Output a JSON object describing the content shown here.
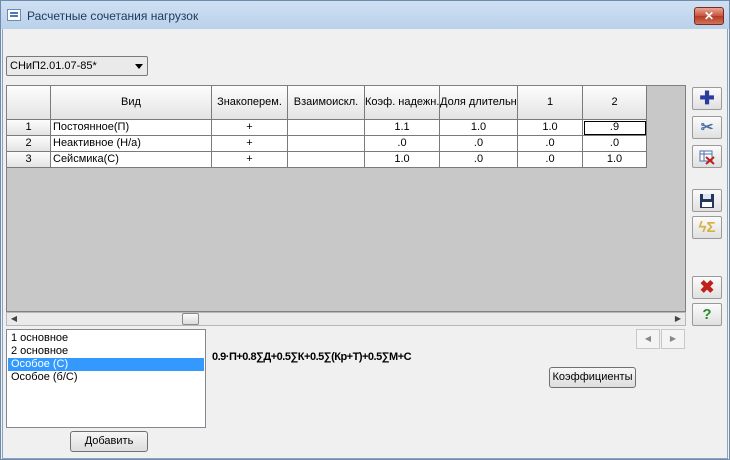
{
  "window": {
    "title": "Расчетные сочетания нагрузок",
    "close": "✕"
  },
  "norm_select": {
    "value": "СНиП2.01.07-85*"
  },
  "table": {
    "columns": [
      "Вид",
      "Знакоперем.",
      "Взаимоискл.",
      "Коэф. надежн.",
      "Доля длительн.",
      "1",
      "2"
    ],
    "rows": [
      {
        "num": "1",
        "vid": "Постоянное(П)",
        "znak": "+",
        "vzaim": "",
        "koef": "1.1",
        "dolya": "1.0",
        "c1": "1.0",
        "c2": ".9"
      },
      {
        "num": "2",
        "vid": "Неактивное (Н/а)",
        "znak": "+",
        "vzaim": "",
        "koef": ".0",
        "dolya": ".0",
        "c1": ".0",
        "c2": ".0"
      },
      {
        "num": "3",
        "vid": "Сейсмика(С)",
        "znak": "+",
        "vzaim": "",
        "koef": "1.0",
        "dolya": ".0",
        "c1": ".0",
        "c2": "1.0"
      }
    ]
  },
  "combos": [
    "1 основное",
    "2 основное",
    "Особое (С)",
    "Особое (б/С)"
  ],
  "selected_combo": "Особое (С)",
  "formula": "0.9·П+0.8∑Д+0.5∑К+0.5∑(Кр+Т)+0.5∑М+С",
  "buttons": {
    "add": "Добавить",
    "coefficients": "Коэффициенты"
  },
  "icons": {
    "add_row": "plus-icon",
    "cut": "scissors-icon",
    "delete_table": "table-delete-icon",
    "save": "floppy-icon",
    "sum": "lightning-sum-icon",
    "close": "red-x-icon",
    "help": "question-icon"
  },
  "colors": {
    "selection": "#3399ff",
    "header_bg": "#c8c8c8"
  }
}
